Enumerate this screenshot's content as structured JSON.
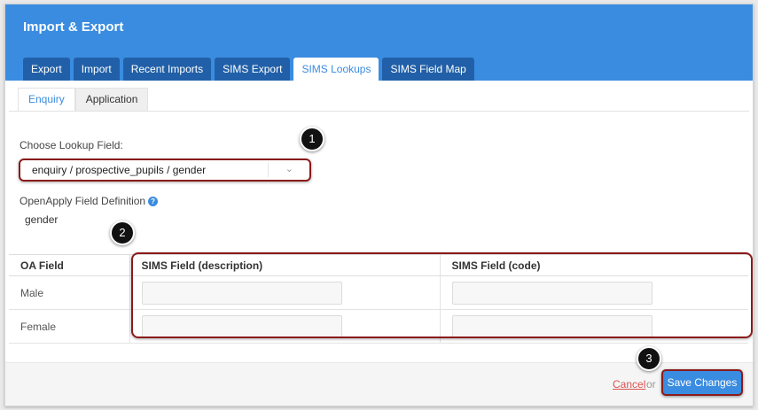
{
  "header": {
    "title": "Import & Export"
  },
  "main_tabs": [
    {
      "label": "Export"
    },
    {
      "label": "Import"
    },
    {
      "label": "Recent Imports"
    },
    {
      "label": "SIMS Export"
    },
    {
      "label": "SIMS Lookups",
      "active": true
    },
    {
      "label": "SIMS Field Map"
    }
  ],
  "sub_tabs": [
    {
      "label": "Enquiry",
      "active": true
    },
    {
      "label": "Application"
    }
  ],
  "lookup": {
    "label": "Choose Lookup Field:",
    "selected": "enquiry / prospective_pupils / gender",
    "chevron": "chevron-down-icon"
  },
  "definition": {
    "label": "OpenApply Field Definition",
    "help_icon": "?",
    "value": "gender"
  },
  "table": {
    "headers": [
      "OA Field",
      "SIMS Field (description)",
      "SIMS Field (code)"
    ],
    "rows": [
      {
        "oa_field": "Male",
        "description": "",
        "code": ""
      },
      {
        "oa_field": "Female",
        "description": "",
        "code": ""
      }
    ]
  },
  "badges": [
    "1",
    "2",
    "3"
  ],
  "footer": {
    "cancel_label": "Cancel",
    "or_label": "or",
    "save_label": "Save Changes"
  },
  "colors": {
    "header_blue": "#3a8ce0",
    "tab_dark_blue": "#2160a8",
    "annotation_red": "#8b1a1a",
    "cancel_red": "#d9534f"
  }
}
